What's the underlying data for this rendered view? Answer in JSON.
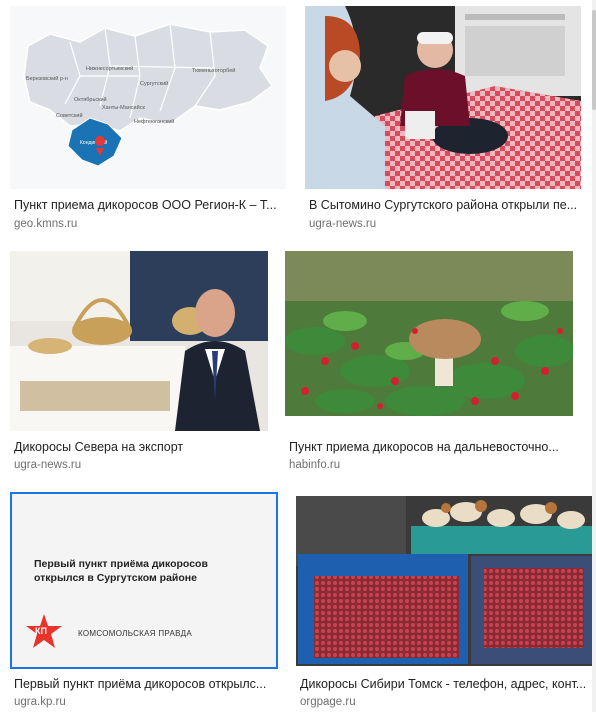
{
  "results": [
    {
      "caption": "Пункт приема дикоросов ООО Регион-К – Т...",
      "domain": "geo.kmns.ru",
      "map_labels": [
        "Березовский р-н",
        "Нижнесортымский",
        "Сургутский",
        "Тюменьхоторбей",
        "Октябрьский",
        "Ханты-Мансийск",
        "Советский",
        "Нефтеюганский",
        "Кондинский"
      ]
    },
    {
      "caption": "В Сытомино Сургутского района открыли пе...",
      "domain": "ugra-news.ru"
    },
    {
      "caption": "Дикоросы Севера на экспорт",
      "domain": "ugra-news.ru"
    },
    {
      "caption": "Пункт приема дикоросов на дальневосточно...",
      "domain": "habinfo.ru"
    },
    {
      "caption": "Первый пункт приёма дикоросов открылс...",
      "domain": "ugra.kp.ru",
      "thumb_headline_1": "Первый пункт приёма дикоросов",
      "thumb_headline_2": "открылся в Сургутском районе",
      "thumb_logo": "КП",
      "thumb_brand": "КОМСОМОЛЬСКАЯ ПРАВДА"
    },
    {
      "caption": "Дикоросы Сибири Томск - телефон, адрес, конт...",
      "domain": "orgpage.ru"
    }
  ]
}
